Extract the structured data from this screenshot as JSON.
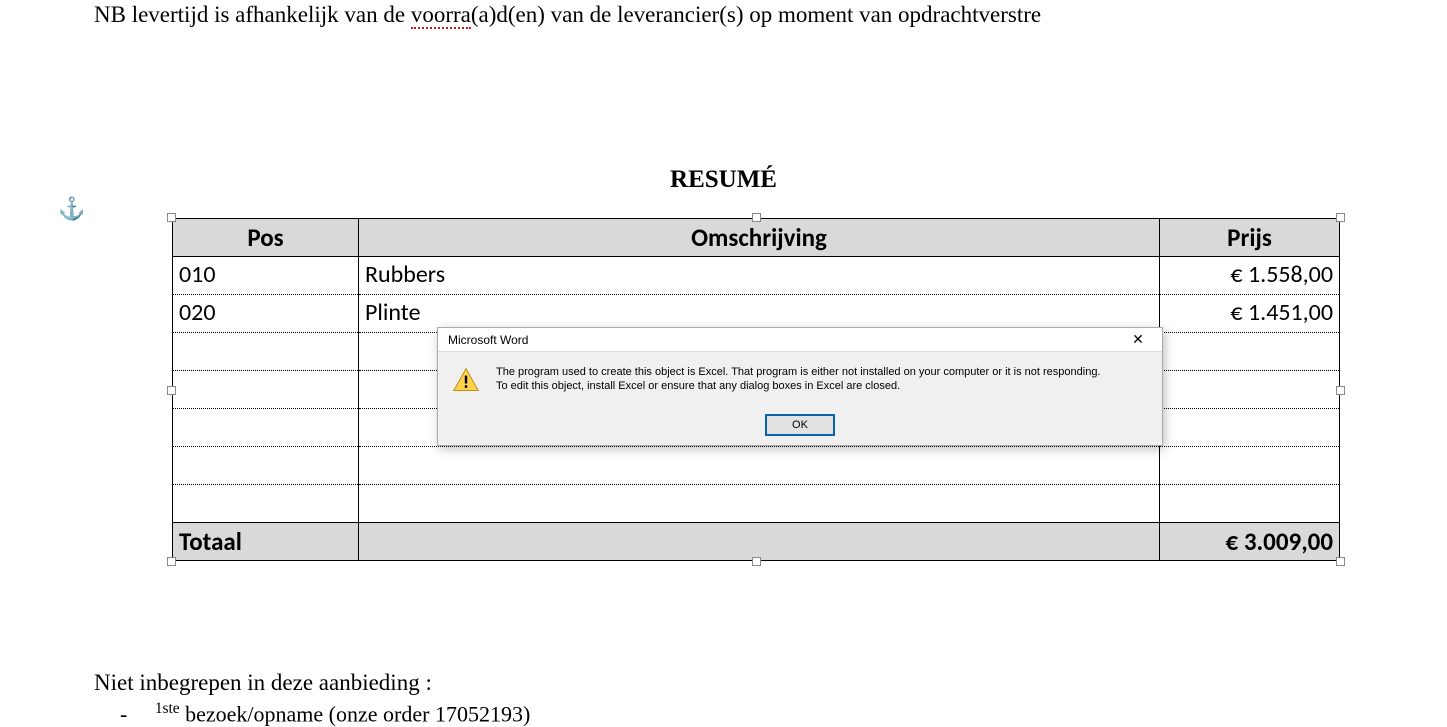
{
  "doc": {
    "top_line_prefix": "NB levertijd is afhankelijk van de ",
    "top_line_squiggle": "voorra",
    "top_line_suffix": "(a)d(en) van de leverancier(s) op moment van opdrachtverstre",
    "resume_title": "RESUMÉ",
    "bottom_line": "Niet inbegrepen in deze aanbieding :",
    "bullet_dash": "-",
    "bullet_sup": "1ste",
    "bullet_text": " bezoek/opname (onze order 17052193)"
  },
  "table": {
    "headers": {
      "pos": "Pos",
      "desc": "Omschrijving",
      "price": "Prijs"
    },
    "rows": [
      {
        "pos": "010",
        "desc": "Rubbers",
        "price": "€ 1.558,00"
      },
      {
        "pos": "020",
        "desc": "Plinte",
        "price": "€ 1.451,00"
      }
    ],
    "total_label": "Totaal",
    "total_value": "€ 3.009,00"
  },
  "dialog": {
    "title": "Microsoft Word",
    "message_line1": "The program used to create this object is Excel.  That program is either not installed on your computer or it is not responding.",
    "message_line2": "To edit this object, install Excel or ensure that any dialog boxes in Excel are closed.",
    "ok_label": "OK"
  }
}
